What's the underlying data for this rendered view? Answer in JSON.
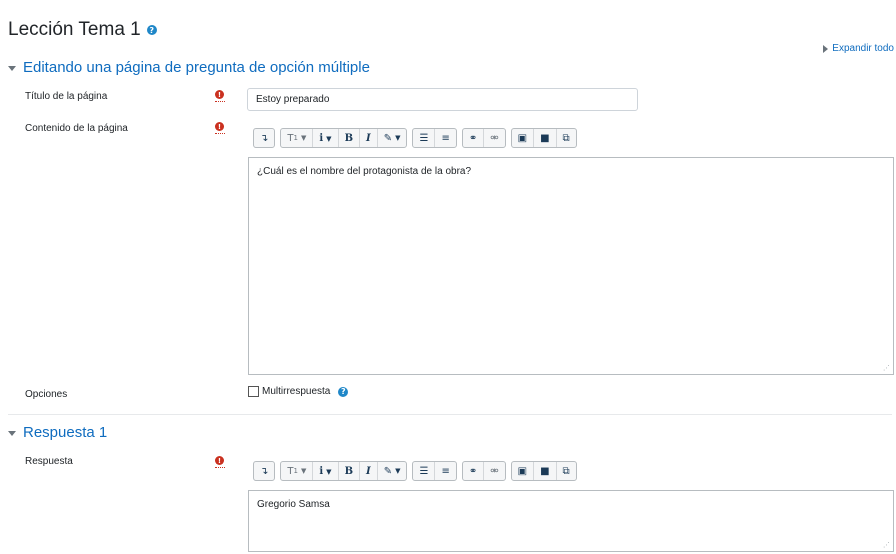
{
  "page": {
    "title": "Lección Tema 1",
    "help_icon": "question-circle-icon",
    "expand_all": "Expandir todo"
  },
  "section_edit": {
    "heading": "Editando una página de pregunta de opción múltiple",
    "title_label": "Título de la página",
    "title_value": "Estoy preparado",
    "content_label": "Contenido de la página",
    "content_text": "¿Cuál es el nombre del protagonista de la obra?",
    "options_label": "Opciones",
    "multi_label": "Multirrespuesta",
    "multi_checked": false
  },
  "section_answer": {
    "heading": "Respuesta 1",
    "answer_label": "Respuesta",
    "answer_text": "Gregorio Samsa"
  },
  "toolbar_icons": [
    "toggle-toolbar-icon",
    "paragraph-style-icon",
    "info-icon",
    "bold-icon",
    "italic-icon",
    "text-color-icon",
    "bullet-list-icon",
    "numbered-list-icon",
    "link-icon",
    "unlink-icon",
    "image-icon",
    "media-icon",
    "manage-files-icon"
  ],
  "colors": {
    "link": "#0f6cbf",
    "required": "#ca3120",
    "help": "#1f87c8"
  }
}
